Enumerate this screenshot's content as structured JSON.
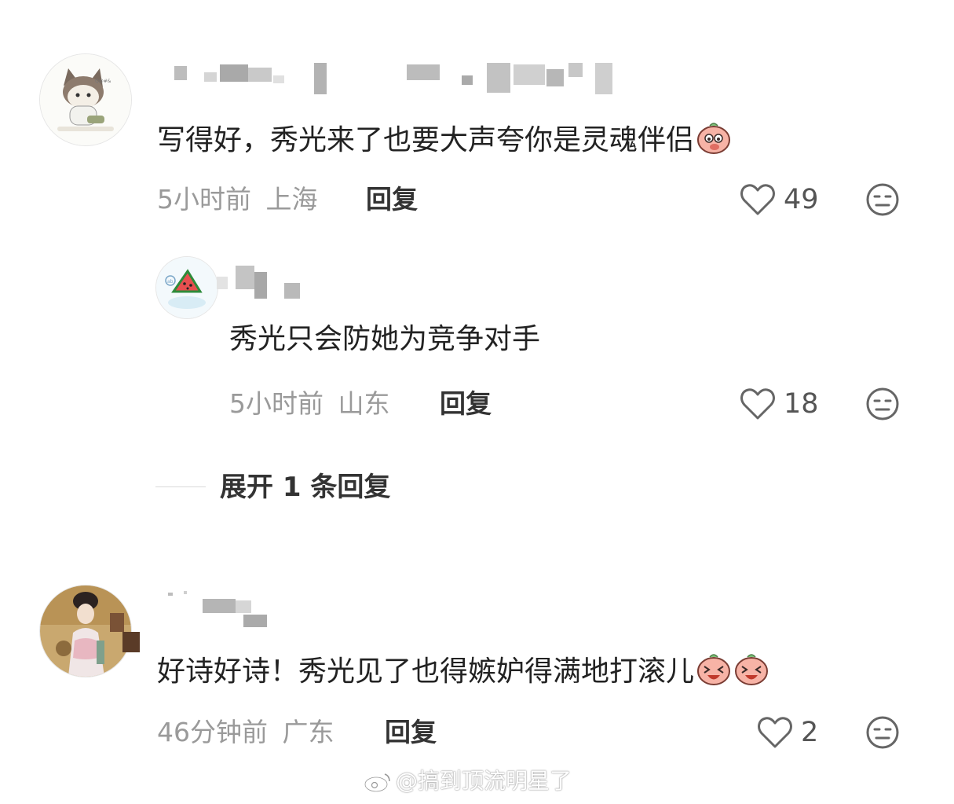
{
  "comments": [
    {
      "text": "写得好，秀光来了也要大声夸你是灵魂伴侣",
      "sticker": "smirk-peach-emoji",
      "time": "5小时前",
      "location": "上海",
      "reply_label": "回复",
      "likes": "49",
      "avatar": "cat-cartoon-avatar",
      "replies": [
        {
          "text": "秀光只会防她为竞争对手",
          "time": "5小时前",
          "location": "山东",
          "reply_label": "回复",
          "likes": "18",
          "avatar": "watermelon-avatar"
        }
      ],
      "expand_label": "展开 1 条回复"
    },
    {
      "text": "好诗好诗！秀光见了也得嫉妒得满地打滚儿",
      "sticker": "laughing-peach-emoji",
      "time": "46分钟前",
      "location": "广东",
      "reply_label": "回复",
      "likes": "2",
      "avatar": "ancient-lady-avatar"
    }
  ],
  "watermark": "@搞到顶流明星了",
  "icons": {
    "like": "heart-outline-icon",
    "dislike": "meh-face-icon"
  },
  "colors": {
    "meta_text": "#9a9a9a",
    "body_text": "#222222",
    "icon": "#666666"
  }
}
